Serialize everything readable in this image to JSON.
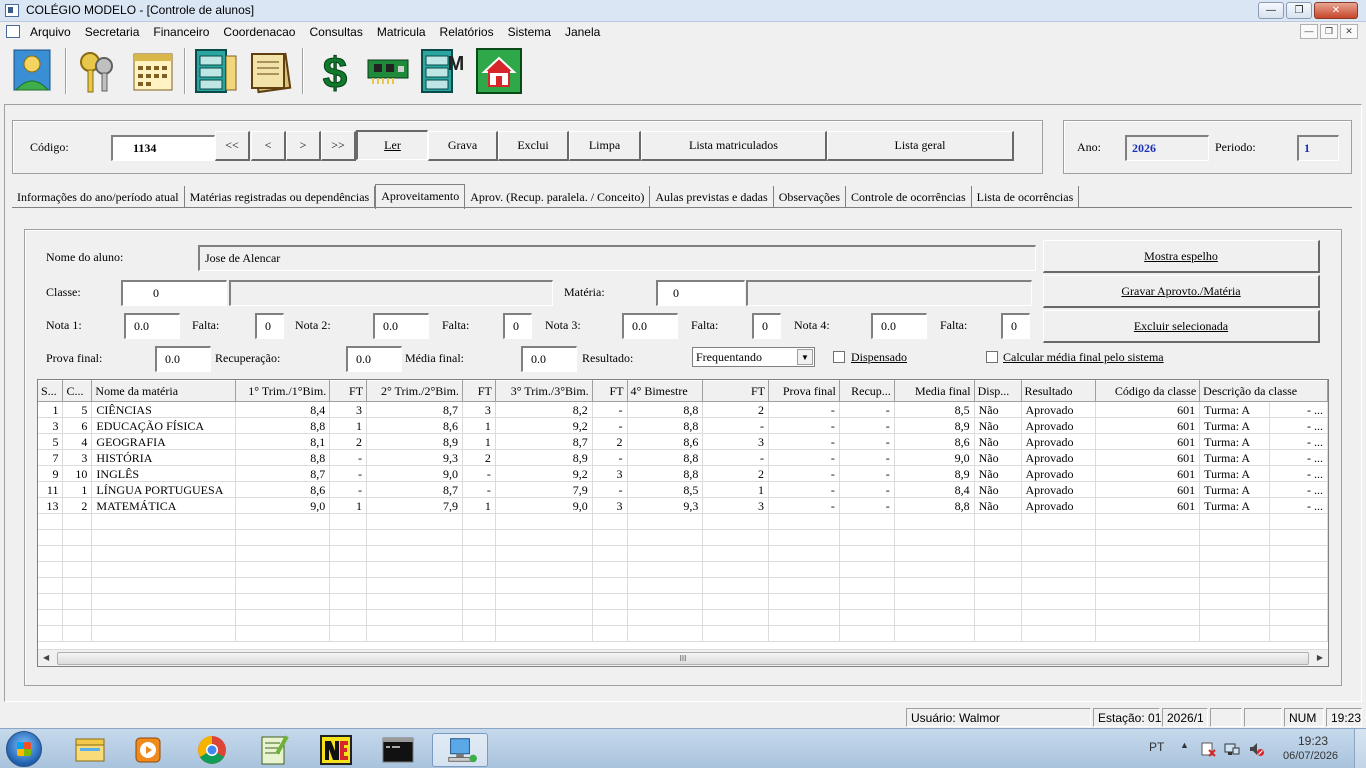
{
  "window": {
    "title": "COLÉGIO MODELO - [Controle de alunos]"
  },
  "menu": [
    "Arquivo",
    "Secretaria",
    "Financeiro",
    "Coordenacao",
    "Consultas",
    "Matricula",
    "Relatórios",
    "Sistema",
    "Janela"
  ],
  "toolbar": {
    "icons": [
      "users-map-icon",
      "keys-icon",
      "calendar-icon",
      "file-cabinet-icon",
      "documents-icon",
      "dollar-icon",
      "network-card-icon",
      "cabinet-m-icon",
      "home-icon"
    ],
    "dollar_glyph": "$",
    "cabinet_letter": "M"
  },
  "header": {
    "codigo_label": "Código:",
    "codigo_value": "1134",
    "nav_first": "<<",
    "nav_prev": "<",
    "nav_next": ">",
    "nav_last": ">>",
    "ler": "Ler",
    "grava": "Grava",
    "exclui": "Exclui",
    "limpa": "Limpa",
    "lista_matriculados": "Lista matriculados",
    "lista_geral": "Lista geral",
    "ano_label": "Ano:",
    "ano_value": "2026",
    "periodo_label": "Periodo:",
    "periodo_value": "1"
  },
  "tabs": [
    "Informações do ano/período atual",
    "Matérias registradas ou dependências",
    "Aproveitamento",
    "Aprov. (Recup. paralela. / Conceito)",
    "Aulas previstas e dadas",
    "Observações",
    "Controle de ocorrências",
    "Lista de ocorrências"
  ],
  "active_tab": "Aproveitamento",
  "form": {
    "nome_label": "Nome do aluno:",
    "nome_value": "Jose de Alencar",
    "classe_label": "Classe:",
    "classe_value": "0",
    "classe_desc": "",
    "materia_label": "Matéria:",
    "materia_value": "0",
    "materia_desc": "",
    "nota1_label": "Nota 1:",
    "nota1_value": "0.0",
    "falta1_label": "Falta:",
    "falta1_value": "0",
    "nota2_label": "Nota 2:",
    "nota2_value": "0.0",
    "falta2_label": "Falta:",
    "falta2_value": "0",
    "nota3_label": "Nota 3:",
    "nota3_value": "0.0",
    "falta3_label": "Falta:",
    "falta3_value": "0",
    "nota4_label": "Nota 4:",
    "nota4_value": "0.0",
    "falta4_label": "Falta:",
    "falta4_value": "0",
    "prova_final_label": "Prova final:",
    "prova_final_value": "0.0",
    "recuperacao_label": "Recuperação:",
    "recuperacao_value": "0.0",
    "media_final_label": "Média final:",
    "media_final_value": "0.0",
    "resultado_label": "Resultado:",
    "resultado_value": "Frequentando",
    "dispensado_label": "Dispensado",
    "calcular_label": "Calcular média final pelo sistema",
    "mostra_espelho": "Mostra espelho",
    "gravar_aprovto": "Gravar Aprovto./Matéria",
    "excluir_selecionada": "Excluir selecionada"
  },
  "grid": {
    "columns": [
      "S...",
      "C...",
      "Nome da matéria",
      "1° Trim./1°Bim.",
      "FT",
      "2° Trim./2°Bim.",
      "FT",
      "3° Trim./3°Bim.",
      "FT",
      "4° Bimestre",
      "FT",
      "Prova final",
      "Recup...",
      "Media final",
      "Disp...",
      "Resultado",
      "Código da classe",
      "Descrição da classe"
    ],
    "rows": [
      [
        "1",
        "5",
        "CIÊNCIAS",
        "8,4",
        "3",
        "8,7",
        "3",
        "8,2",
        "-",
        "8,8",
        "2",
        "-",
        "-",
        "8,5",
        "Não",
        "Aprovado",
        "601",
        "Turma: A",
        "- ..."
      ],
      [
        "3",
        "6",
        "EDUCAÇÃO FÍSICA",
        "8,8",
        "1",
        "8,6",
        "1",
        "9,2",
        "-",
        "8,8",
        "-",
        "-",
        "-",
        "8,9",
        "Não",
        "Aprovado",
        "601",
        "Turma: A",
        "- ..."
      ],
      [
        "5",
        "4",
        "GEOGRAFIA",
        "8,1",
        "2",
        "8,9",
        "1",
        "8,7",
        "2",
        "8,6",
        "3",
        "-",
        "-",
        "8,6",
        "Não",
        "Aprovado",
        "601",
        "Turma: A",
        "- ..."
      ],
      [
        "7",
        "3",
        "HISTÓRIA",
        "8,8",
        "-",
        "9,3",
        "2",
        "8,9",
        "-",
        "8,8",
        "-",
        "-",
        "-",
        "9,0",
        "Não",
        "Aprovado",
        "601",
        "Turma: A",
        "- ..."
      ],
      [
        "9",
        "10",
        "INGLÊS",
        "8,7",
        "-",
        "9,0",
        "-",
        "9,2",
        "3",
        "8,8",
        "2",
        "-",
        "-",
        "8,9",
        "Não",
        "Aprovado",
        "601",
        "Turma: A",
        "- ..."
      ],
      [
        "11",
        "1",
        "LÍNGUA PORTUGUESA",
        "8,6",
        "-",
        "8,7",
        "-",
        "7,9",
        "-",
        "8,5",
        "1",
        "-",
        "-",
        "8,4",
        "Não",
        "Aprovado",
        "601",
        "Turma: A",
        "- ..."
      ],
      [
        "13",
        "2",
        "MATEMÁTICA",
        "9,0",
        "1",
        "7,9",
        "1",
        "9,0",
        "3",
        "9,3",
        "3",
        "-",
        "-",
        "8,8",
        "Não",
        "Aprovado",
        "601",
        "Turma: A",
        "- ..."
      ]
    ],
    "scroll_grip": "III"
  },
  "status": {
    "usuario": "Usuário: Walmor",
    "estacao": "Estação: 01",
    "periodo": "2026/1",
    "num": "NUM",
    "hora": "19:23"
  },
  "taskbar": {
    "apps": [
      "explorer-icon",
      "media-player-icon",
      "chrome-icon",
      "notepad-plus-icon",
      "nero-icon",
      "cmd-icon",
      "colegio-app-icon"
    ],
    "lang": "PT",
    "clock_time": "19:23",
    "clock_date": "06/07/2026"
  },
  "colors": {
    "accent_blue": "#1a2fb4",
    "titlebar": "#dbe6f4"
  }
}
